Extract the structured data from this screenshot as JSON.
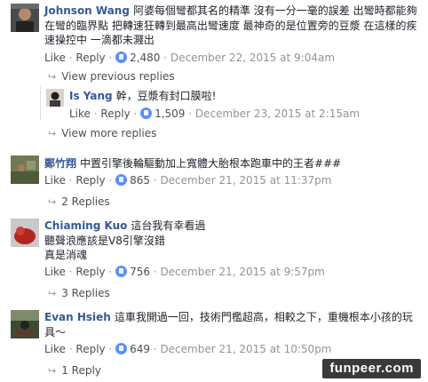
{
  "comments": [
    {
      "author": "Johnson Wang",
      "text": "阿婆每個彎都其名的精準 沒有一分一毫的誤差 出彎時都能夠在彎的臨界點 把轉速狂轉到最高出彎速度 最神奇的是位置旁的豆漿 在這樣的疾速操控中 一滴都未濺出",
      "like": "Like",
      "reply": "Reply",
      "likes": "2,480",
      "date": "December 22, 2015 at 9:04am",
      "view_previous": "View previous replies",
      "view_more": "View more replies",
      "sub_reply": {
        "author": "Is Yang",
        "text": "幹，豆漿有封口膜啦!",
        "like": "Like",
        "reply": "Reply",
        "likes": "1,509",
        "date": "December 23, 2015 at 2:15am"
      }
    },
    {
      "author": "鄭竹翔",
      "text": "中置引擎後輪驅動加上寬體大胎根本跑車中的王者###",
      "like": "Like",
      "reply": "Reply",
      "likes": "865",
      "date": "December 21, 2015 at 11:37pm",
      "replies": "2 Replies"
    },
    {
      "author": "Chiaming Kuo",
      "text_lines": [
        "這台我有幸看過",
        "聽聲浪應該是V8引擎沒錯",
        "真是消魂"
      ],
      "like": "Like",
      "reply": "Reply",
      "likes": "756",
      "date": "December 21, 2015 at 9:57pm",
      "replies": "3 Replies"
    },
    {
      "author": "Evan Hsieh",
      "text": "這車我開過一回，技術門檻超高，相較之下，重機根本小孩的玩具～",
      "like": "Like",
      "reply": "Reply",
      "likes": "649",
      "date": "December 21, 2015 at 10:50pm",
      "replies": "1 Reply"
    }
  ],
  "watermark": "funpeer.com",
  "colors": {
    "author": "#365899",
    "meta": "#90949c",
    "like_badge": "#5890ff"
  }
}
